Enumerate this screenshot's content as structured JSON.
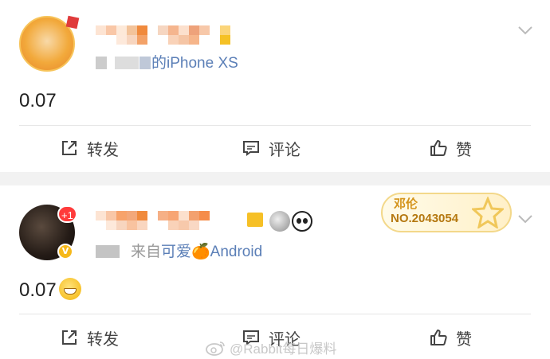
{
  "posts": [
    {
      "source": "的iPhone XS",
      "content": "0.07",
      "actions": {
        "repost": "转发",
        "comment": "评论",
        "like": "赞"
      }
    },
    {
      "badge": "+1",
      "source_prefix": "来自",
      "source": "可爱🍊Android",
      "content": "0.07",
      "actions": {
        "repost": "转发",
        "comment": "评论",
        "like": "赞"
      },
      "fan_card": {
        "name": "邓伦",
        "number": "NO.2043054"
      }
    }
  ],
  "watermark": "@Rabbit每日爆料",
  "colors": {
    "link": "#5b7fb7",
    "badge_red": "#ff3b3b",
    "verified_gold": "#f6b81a"
  },
  "icons": [
    "repost-icon",
    "comment-icon",
    "like-icon",
    "chevron-down-icon",
    "weibo-logo-icon"
  ]
}
